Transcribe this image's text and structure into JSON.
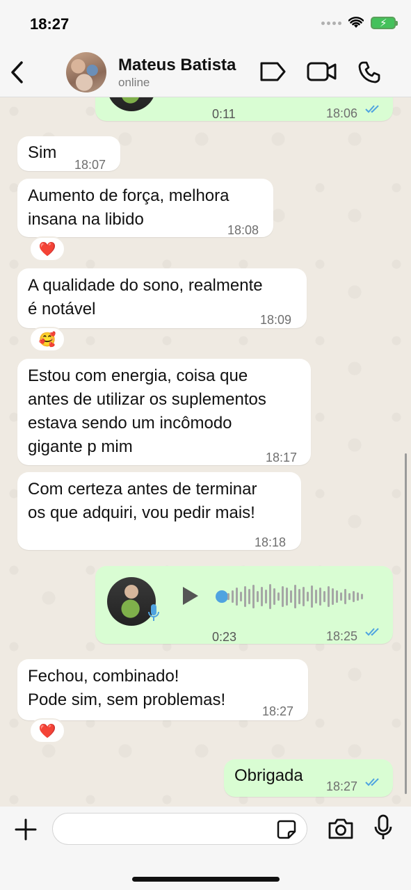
{
  "status_bar": {
    "time": "18:27",
    "battery_color": "#44c15b"
  },
  "header": {
    "contact_name": "Mateus Batista",
    "contact_status": "online",
    "icons": [
      "chevron-left-icon",
      "label-tag-icon",
      "video-camera-icon",
      "phone-icon"
    ]
  },
  "messages": [
    {
      "type": "voice",
      "direction": "out",
      "duration": "0:11",
      "time": "18:06",
      "status": "read"
    },
    {
      "type": "text",
      "direction": "in",
      "text": "Sim",
      "time": "18:07"
    },
    {
      "type": "text",
      "direction": "in",
      "text": "Aumento de força,  melhora\ninsana na libido",
      "time": "18:08",
      "reaction": "❤️"
    },
    {
      "type": "text",
      "direction": "in",
      "text": "A qualidade do sono, realmente\né notável",
      "time": "18:09",
      "reaction": "🥰"
    },
    {
      "type": "text",
      "direction": "in",
      "text": "Estou com energia, coisa que\nantes de utilizar os suplementos\nestava sendo um incômodo\ngigante p mim",
      "time": "18:17"
    },
    {
      "type": "text",
      "direction": "in",
      "text": "Com certeza antes de terminar\nos que adquiri, vou  pedir mais!",
      "time": "18:18"
    },
    {
      "type": "voice",
      "direction": "out",
      "duration": "0:23",
      "time": "18:25",
      "status": "read",
      "progress": 0
    },
    {
      "type": "text",
      "direction": "in",
      "text": "Fechou, combinado!\nPode sim, sem problemas!",
      "time": "18:27",
      "reaction": "❤️"
    },
    {
      "type": "text",
      "direction": "out",
      "text": "Obrigada",
      "time": "18:27",
      "status": "read"
    }
  ],
  "composer": {
    "icons": [
      "plus-icon",
      "sticker-icon",
      "camera-icon",
      "microphone-icon"
    ]
  },
  "colors": {
    "outgoing_bubble": "#d9fdd3",
    "incoming_bubble": "#ffffff",
    "read_ticks": "#4fa3e0",
    "chat_background": "#efeae2"
  }
}
